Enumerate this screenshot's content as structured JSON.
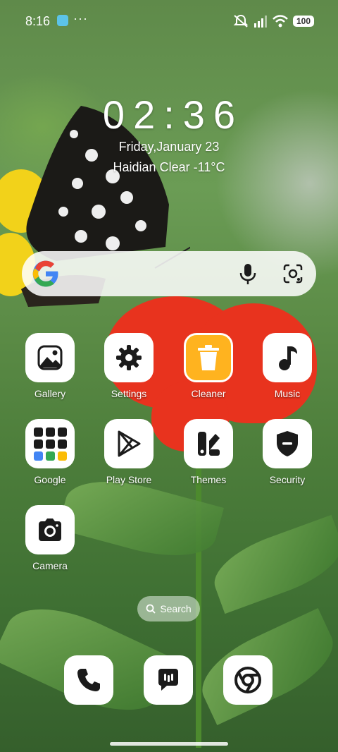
{
  "status_bar": {
    "time": "8:16",
    "dots": "···",
    "battery": "100"
  },
  "clock_widget": {
    "time": "02:36",
    "date": "Friday,January 23",
    "weather": "Haidian Clear -11°C"
  },
  "apps": {
    "gallery": "Gallery",
    "settings": "Settings",
    "cleaner": "Cleaner",
    "music": "Music",
    "google": "Google",
    "play_store": "Play Store",
    "themes": "Themes",
    "security": "Security",
    "camera": "Camera"
  },
  "search_pill": {
    "label": "Search"
  },
  "dock": [
    "phone-icon",
    "messages-icon",
    "chrome-icon"
  ],
  "colors": {
    "cleaner_tile": "#ffb31f",
    "icon_dark": "#1b1b1b"
  }
}
